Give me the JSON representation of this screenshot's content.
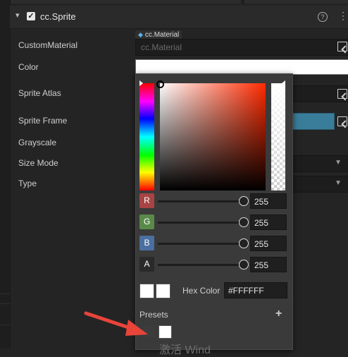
{
  "component": {
    "title": "cc.Sprite",
    "enabled": true
  },
  "properties": [
    {
      "label": "CustomMaterial"
    },
    {
      "label": "Color"
    },
    {
      "label": "Sprite Atlas"
    },
    {
      "label": "Sprite Frame"
    },
    {
      "label": "Grayscale"
    },
    {
      "label": "Size Mode"
    },
    {
      "label": "Type"
    }
  ],
  "material": {
    "tag": "cc.Material",
    "placeholder": "cc.Material"
  },
  "color_picker": {
    "channels": [
      {
        "label": "R",
        "value": "255",
        "color": "#a84444"
      },
      {
        "label": "G",
        "value": "255",
        "color": "#5a8a4a"
      },
      {
        "label": "B",
        "value": "255",
        "color": "#4a6fa0"
      },
      {
        "label": "A",
        "value": "255",
        "color": "#2a2a2a"
      }
    ],
    "hex_label": "Hex Color",
    "hex_value": "#FFFFFF",
    "presets_label": "Presets",
    "add_preset": "+",
    "current_color": "#FFFFFF"
  },
  "behind_text": "激活 Wind"
}
